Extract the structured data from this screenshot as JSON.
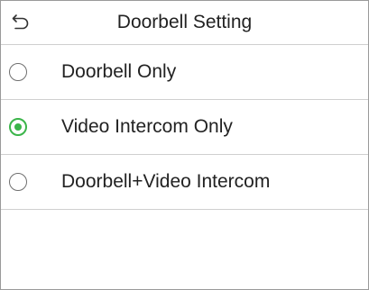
{
  "header": {
    "title": "Doorbell Setting",
    "back_icon": "back-arrow-icon"
  },
  "options": [
    {
      "label": "Doorbell Only",
      "selected": false
    },
    {
      "label": "Video Intercom Only",
      "selected": true
    },
    {
      "label": "Doorbell+Video Intercom",
      "selected": false
    }
  ],
  "colors": {
    "accent": "#3bb54a",
    "divider": "#cfcfcf",
    "text": "#222222"
  }
}
